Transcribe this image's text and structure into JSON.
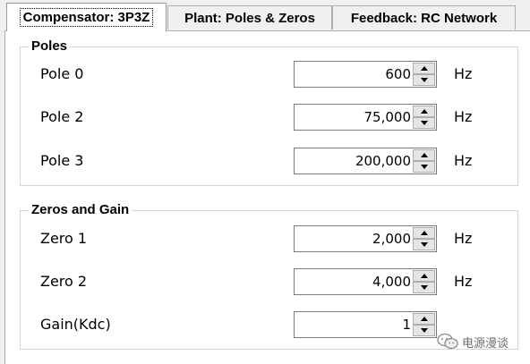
{
  "tabs": [
    {
      "label": "Compensator: 3P3Z",
      "active": true
    },
    {
      "label": "Plant: Poles & Zeros",
      "active": false
    },
    {
      "label": "Feedback: RC Network",
      "active": false
    }
  ],
  "poles": {
    "title": "Poles",
    "rows": [
      {
        "label": "Pole 0",
        "value": "600",
        "unit": "Hz"
      },
      {
        "label": "Pole 2",
        "value": "75,000",
        "unit": "Hz"
      },
      {
        "label": "Pole 3",
        "value": "200,000",
        "unit": "Hz"
      }
    ]
  },
  "zeros_gain": {
    "title": "Zeros and Gain",
    "rows": [
      {
        "label": "Zero 1",
        "value": "2,000",
        "unit": "Hz"
      },
      {
        "label": "Zero 2",
        "value": "4,000",
        "unit": "Hz"
      },
      {
        "label": "Gain(Kdc)",
        "value": "1",
        "unit": ""
      }
    ]
  },
  "watermark": {
    "text": "电源漫谈",
    "icon": "wechat-icon"
  }
}
